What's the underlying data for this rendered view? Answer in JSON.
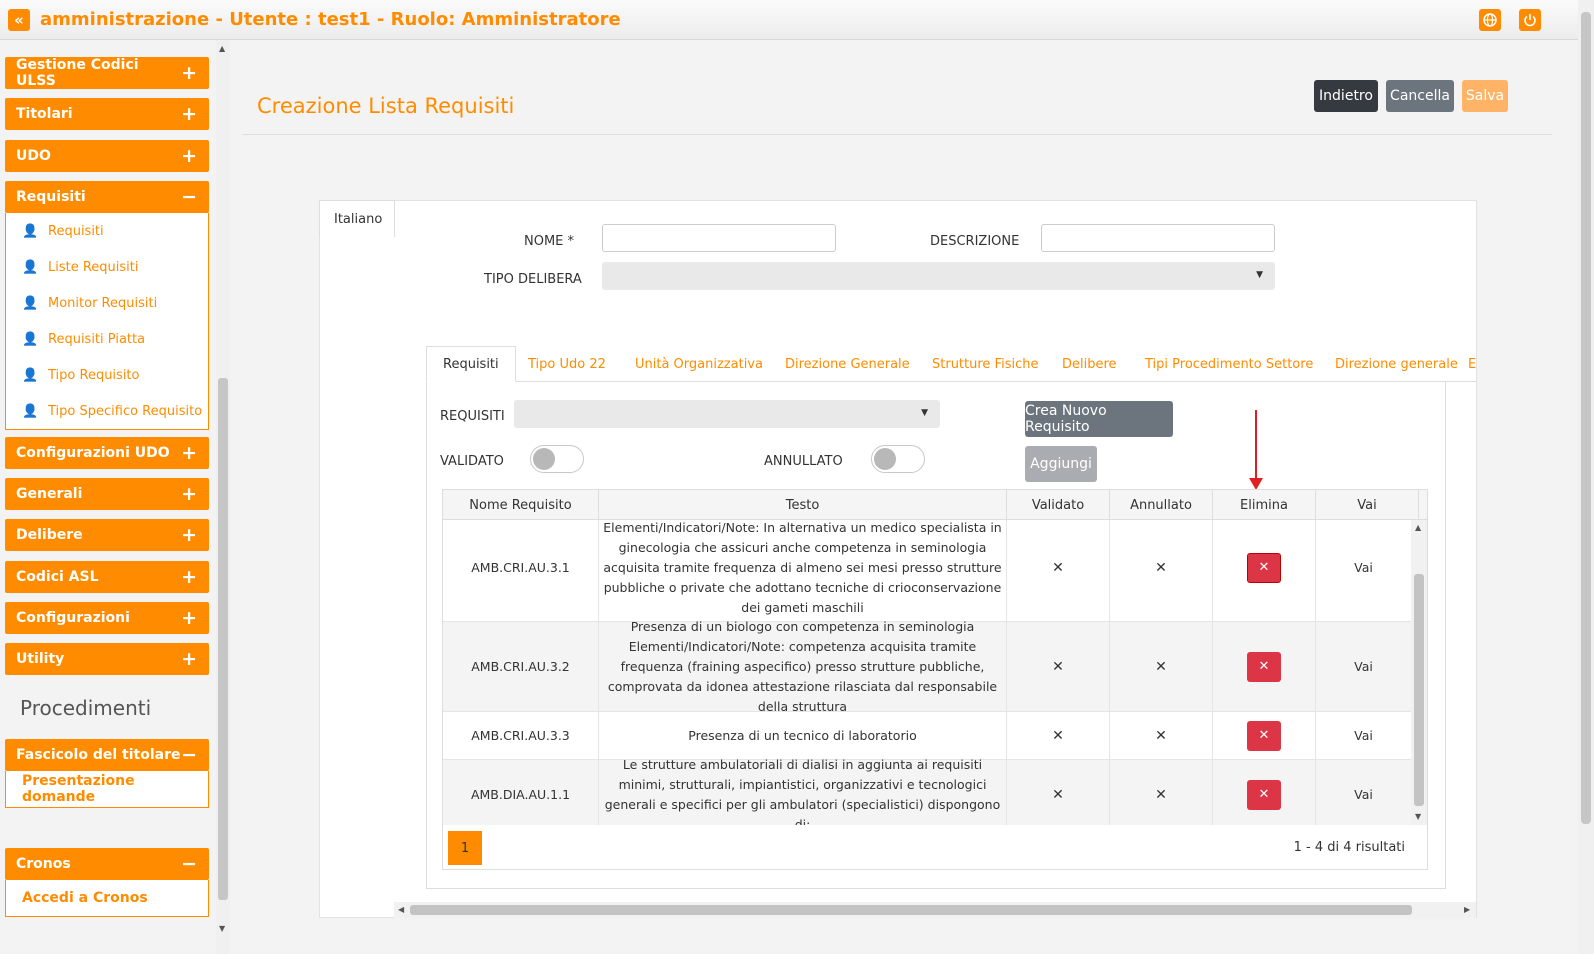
{
  "header": {
    "title": "amministrazione - Utente : test1 - Ruolo: Amministratore",
    "collapse_icon": "double-chevron-left-icon",
    "globe_icon": "globe-icon",
    "power_icon": "power-icon"
  },
  "sidebar": {
    "menus": [
      {
        "label": "Gestione Codici ULSS",
        "sign": "+"
      },
      {
        "label": "Titolari",
        "sign": "+"
      },
      {
        "label": "UDO",
        "sign": "+"
      },
      {
        "label": "Requisiti",
        "sign": "−"
      },
      {
        "label": "Configurazioni UDO",
        "sign": "+"
      },
      {
        "label": "Generali",
        "sign": "+"
      },
      {
        "label": "Delibere",
        "sign": "+"
      },
      {
        "label": "Codici ASL",
        "sign": "+"
      },
      {
        "label": "Configurazioni",
        "sign": "+"
      },
      {
        "label": "Utility",
        "sign": "+"
      }
    ],
    "requisiti_items": [
      "Requisiti",
      "Liste Requisiti",
      "Monitor Requisiti",
      "Requisiti Piatta",
      "Tipo Requisito",
      "Tipo Specifico Requisito"
    ],
    "procedimenti_heading": "Procedimenti",
    "fascicolo": {
      "label": "Fascicolo del titolare",
      "sign": "−",
      "item": "Presentazione domande"
    },
    "cronos": {
      "label": "Cronos",
      "sign": "−",
      "item": "Accedi a Cronos"
    }
  },
  "page": {
    "title": "Creazione Lista Requisiti",
    "buttons": {
      "back": "Indietro",
      "cancel": "Cancella",
      "save": "Salva"
    }
  },
  "form": {
    "lang_tab": "Italiano",
    "nome_label": "NOME *",
    "nome_value": "",
    "descrizione_label": "DESCRIZIONE",
    "descrizione_value": "",
    "tipo_delibera_label": "TIPO DELIBERA",
    "tipo_delibera_value": ""
  },
  "tabs": [
    "Requisiti",
    "Tipo Udo 22",
    "Unità Organizzativa",
    "Direzione Generale",
    "Strutture Fisiche",
    "Delibere",
    "Tipi Procedimento Settore",
    "Direzione generale",
    "E"
  ],
  "requisiti_panel": {
    "requisiti_label": "REQUISITI",
    "requisiti_value": "",
    "validato_label": "VALIDATO",
    "annullato_label": "ANNULLATO",
    "validato_on": false,
    "annullato_on": false,
    "new_button": "Crea Nuovo Requisito",
    "add_button": "Aggiungi"
  },
  "table": {
    "columns": [
      "Nome Requisito",
      "Testo",
      "Validato",
      "Annullato",
      "Elimina",
      "Vai"
    ],
    "rows": [
      {
        "nome": "AMB.CRI.AU.3.1",
        "testo": "Elementi/Indicatori/Note: In alternativa un medico specialista in ginecologia che assicuri anche competenza in seminologia acquisita tramite frequenza di almeno sei mesi presso strutture pubbliche o private che adottano tecniche di crioconservazione dei gameti maschili",
        "validato": "✕",
        "annullato": "✕",
        "elimina": "✕",
        "vai": "Vai"
      },
      {
        "nome": "AMB.CRI.AU.3.2",
        "testo": "Presenza di un biologo con competenza in seminologia Elementi/Indicatori/Note: competenza acquisita tramite frequenza (fraining aspecifico) presso strutture pubbliche, comprovata da idonea attestazione rilasciata dal responsabile della struttura",
        "validato": "✕",
        "annullato": "✕",
        "elimina": "✕",
        "vai": "Vai"
      },
      {
        "nome": "AMB.CRI.AU.3.3",
        "testo": "Presenza di un tecnico di laboratorio",
        "validato": "✕",
        "annullato": "✕",
        "elimina": "✕",
        "vai": "Vai"
      },
      {
        "nome": "AMB.DIA.AU.1.1",
        "testo": "Le strutture ambulatoriali di dialisi in aggiunta ai requisiti minimi, strutturali, impiantistici, organizzativi e tecnologici generali e specifici per gli ambulatori (specialistici) dispongono di:",
        "validato": "✕",
        "annullato": "✕",
        "elimina": "✕",
        "vai": "Vai"
      }
    ],
    "page": "1",
    "results": "1 - 4 di 4 risultati"
  },
  "colors": {
    "accent": "#ff8c00",
    "danger": "#dc3545",
    "dark": "#343a40",
    "grey": "#6c757d"
  }
}
